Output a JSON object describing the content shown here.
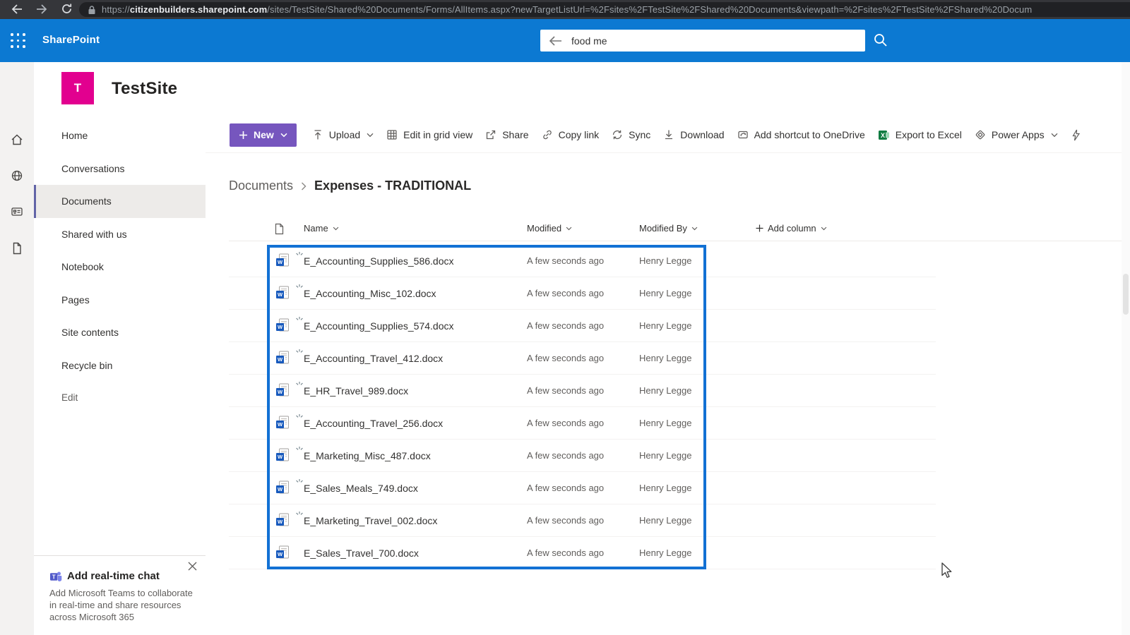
{
  "colors": {
    "browser_bar_bg": "#35363a",
    "url_pill_bg": "#202124",
    "suite_blue": "#0c79d2",
    "logo_pink": "#e2008f",
    "new_purple": "#7656be",
    "nav_accent": "#6264a7",
    "selection_blue": "#1271d4",
    "excel_green": "#107c41",
    "word_blue": "#185abd",
    "teams_purple": "#5059c9",
    "text_dark": "#323130",
    "text_gray": "#605e5c"
  },
  "browser": {
    "url_scheme": "https://",
    "url_domain": "citizenbuilders.sharepoint.com",
    "url_path": "/sites/TestSite/Shared%20Documents/Forms/AllItems.aspx?newTargetListUrl=%2Fsites%2FTestSite%2FShared%20Documents&viewpath=%2Fsites%2FTestSite%2FShared%20Docum"
  },
  "suite_bar": {
    "app_name": "SharePoint",
    "search_value": "food me"
  },
  "site": {
    "logo_letter": "T",
    "title": "TestSite"
  },
  "nav": {
    "items": [
      "Home",
      "Conversations",
      "Documents",
      "Shared with us",
      "Notebook",
      "Pages",
      "Site contents",
      "Recycle bin",
      "Edit"
    ],
    "selected": "Documents"
  },
  "toolbar": {
    "new_label": "New",
    "items": [
      {
        "label": "Upload",
        "icon": "upload-icon",
        "has_chevron": true
      },
      {
        "label": "Edit in grid view",
        "icon": "grid-icon",
        "has_chevron": false
      },
      {
        "label": "Share",
        "icon": "share-icon",
        "has_chevron": false
      },
      {
        "label": "Copy link",
        "icon": "copy-link-icon",
        "has_chevron": false
      },
      {
        "label": "Sync",
        "icon": "sync-icon",
        "has_chevron": false
      },
      {
        "label": "Download",
        "icon": "download-icon",
        "has_chevron": false
      },
      {
        "label": "Add shortcut to OneDrive",
        "icon": "onedrive-shortcut-icon",
        "has_chevron": false
      },
      {
        "label": "Export to Excel",
        "icon": "excel-icon",
        "has_chevron": false
      },
      {
        "label": "Power Apps",
        "icon": "power-apps-icon",
        "has_chevron": true
      }
    ]
  },
  "breadcrumb": {
    "parent": "Documents",
    "current": "Expenses - TRADITIONAL"
  },
  "table": {
    "columns": {
      "name": "Name",
      "modified": "Modified",
      "modified_by": "Modified By"
    },
    "add_column_label": "Add column",
    "rows": [
      {
        "name": "E_Accounting_Supplies_586.docx",
        "modified": "A few seconds ago",
        "modified_by": "Henry Legge",
        "is_new": true
      },
      {
        "name": "E_Accounting_Misc_102.docx",
        "modified": "A few seconds ago",
        "modified_by": "Henry Legge",
        "is_new": true
      },
      {
        "name": "E_Accounting_Supplies_574.docx",
        "modified": "A few seconds ago",
        "modified_by": "Henry Legge",
        "is_new": true
      },
      {
        "name": "E_Accounting_Travel_412.docx",
        "modified": "A few seconds ago",
        "modified_by": "Henry Legge",
        "is_new": true
      },
      {
        "name": "E_HR_Travel_989.docx",
        "modified": "A few seconds ago",
        "modified_by": "Henry Legge",
        "is_new": true
      },
      {
        "name": "E_Accounting_Travel_256.docx",
        "modified": "A few seconds ago",
        "modified_by": "Henry Legge",
        "is_new": true
      },
      {
        "name": "E_Marketing_Misc_487.docx",
        "modified": "A few seconds ago",
        "modified_by": "Henry Legge",
        "is_new": true
      },
      {
        "name": "E_Sales_Meals_749.docx",
        "modified": "A few seconds ago",
        "modified_by": "Henry Legge",
        "is_new": true
      },
      {
        "name": "E_Marketing_Travel_002.docx",
        "modified": "A few seconds ago",
        "modified_by": "Henry Legge",
        "is_new": true
      },
      {
        "name": "E_Sales_Travel_700.docx",
        "modified": "A few seconds ago",
        "modified_by": "Henry Legge",
        "is_new": false
      }
    ]
  },
  "teach_panel": {
    "title": "Add real-time chat",
    "body": "Add Microsoft Teams to collaborate in real-time and share resources across Microsoft 365"
  }
}
